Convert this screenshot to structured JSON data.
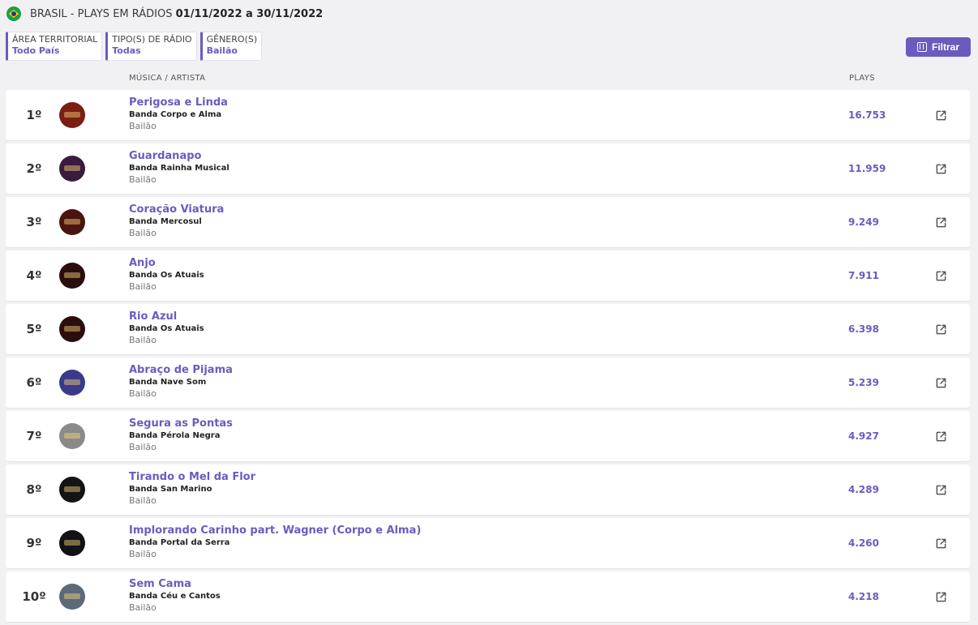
{
  "header": {
    "title": "BRASIL - PLAYS EM RÁDIOS",
    "dates": "01/11/2022 a 30/11/2022",
    "flag_icon": "brazil-flag-icon"
  },
  "filters": [
    {
      "label": "ÁREA TERRITORIAL",
      "value": "Todo País"
    },
    {
      "label": "TIPO(S) DE RÁDIO",
      "value": "Todas"
    },
    {
      "label": "GÊNERO(S)",
      "value": "Bailão"
    }
  ],
  "filter_button": {
    "label": "Filtrar",
    "icon": "sliders-icon"
  },
  "columns": {
    "music": "MÚSICA / ARTISTA",
    "plays": "PLAYS"
  },
  "colors": {
    "accent": "#6b5bbf",
    "background": "#f1f1f4"
  },
  "rows": [
    {
      "rank": "1º",
      "song": "Perigosa e Linda",
      "artist": "Banda Corpo e Alma",
      "genre": "Bailão",
      "plays": "16.753",
      "cover_color": "#7a1e14"
    },
    {
      "rank": "2º",
      "song": "Guardanapo",
      "artist": "Banda Rainha Musical",
      "genre": "Bailão",
      "plays": "11.959",
      "cover_color": "#3a1a3e"
    },
    {
      "rank": "3º",
      "song": "Coração Viatura",
      "artist": "Banda Mercosul",
      "genre": "Bailão",
      "plays": "9.249",
      "cover_color": "#4a1410"
    },
    {
      "rank": "4º",
      "song": "Anjo",
      "artist": "Banda Os Atuais",
      "genre": "Bailão",
      "plays": "7.911",
      "cover_color": "#2a0d0d"
    },
    {
      "rank": "5º",
      "song": "Rio Azul",
      "artist": "Banda Os Atuais",
      "genre": "Bailão",
      "plays": "6.398",
      "cover_color": "#2a0d0d"
    },
    {
      "rank": "6º",
      "song": "Abraço de Pijama",
      "artist": "Banda Nave Som",
      "genre": "Bailão",
      "plays": "5.239",
      "cover_color": "#3b3a8a"
    },
    {
      "rank": "7º",
      "song": "Segura as Pontas",
      "artist": "Banda Pérola Negra",
      "genre": "Bailão",
      "plays": "4.927",
      "cover_color": "#8a8a8a"
    },
    {
      "rank": "8º",
      "song": "Tirando o Mel da Flor",
      "artist": "Banda San Marino",
      "genre": "Bailão",
      "plays": "4.289",
      "cover_color": "#141414"
    },
    {
      "rank": "9º",
      "song": "Implorando Carinho part. Wagner (Corpo e Alma)",
      "artist": "Banda Portal da Serra",
      "genre": "Bailão",
      "plays": "4.260",
      "cover_color": "#111118"
    },
    {
      "rank": "10º",
      "song": "Sem Cama",
      "artist": "Banda Céu e Cantos",
      "genre": "Bailão",
      "plays": "4.218",
      "cover_color": "#5a6a7a"
    }
  ]
}
